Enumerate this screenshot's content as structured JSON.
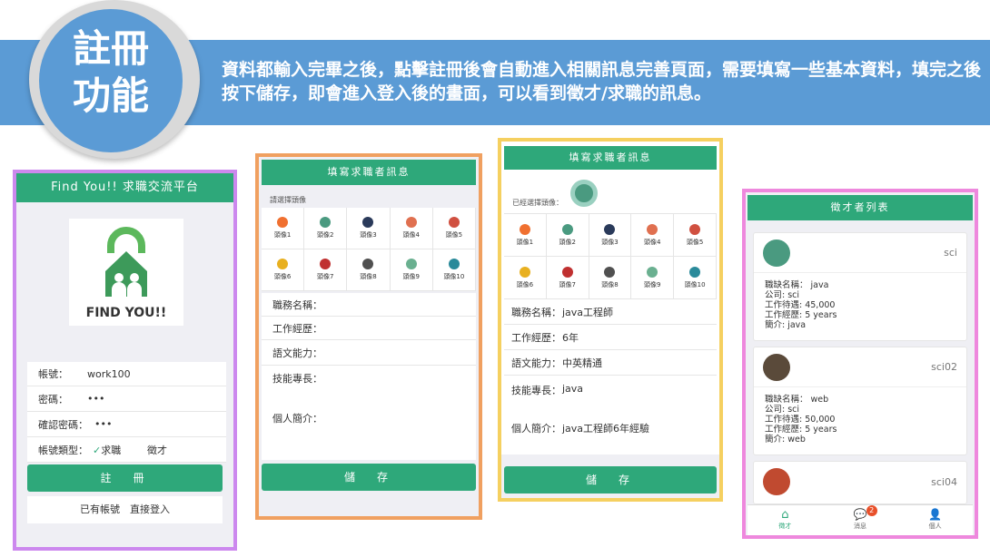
{
  "badge": {
    "line1": "註冊",
    "line2": "功能"
  },
  "banner": {
    "text": "資料都輸入完畢之後，點擊註冊後會自動進入相關訊息完善頁面，需要填寫一些基本資料，填完之後按下儲存，即會進入登入後的畫面，可以看到徵才/求職的訊息。"
  },
  "register": {
    "header": "Find You!! 求職交流平台",
    "logo_text": "FIND YOU!!",
    "fields": [
      {
        "label": "帳號：",
        "value": "work100"
      },
      {
        "label": "密碼：",
        "value": "•••"
      },
      {
        "label": "確認密碼：",
        "value": "•••"
      }
    ],
    "type_label": "帳號類型：",
    "type_option1": "求職",
    "type_option2": "徵才",
    "register_button": "註　冊",
    "login_link": "已有帳號　直接登入"
  },
  "form_empty": {
    "header": "填寫求職者訊息",
    "avatar_prompt": "請選擇頭像",
    "avatars": [
      "頭像1",
      "頭像2",
      "頭像3",
      "頭像4",
      "頭像5",
      "頭像6",
      "頭像7",
      "頭像8",
      "頭像9",
      "頭像10"
    ],
    "fields": [
      {
        "label": "職務名稱：",
        "value": ""
      },
      {
        "label": "工作經歷：",
        "value": ""
      },
      {
        "label": "語文能力：",
        "value": ""
      },
      {
        "label": "技能專長：",
        "value": ""
      },
      {
        "label": "個人簡介：",
        "value": ""
      }
    ],
    "save_button": "儲　存"
  },
  "form_filled": {
    "header": "填寫求職者訊息",
    "avatar_prompt": "已經選擇頭像：",
    "avatars": [
      "頭像1",
      "頭像2",
      "頭像3",
      "頭像4",
      "頭像5",
      "頭像6",
      "頭像7",
      "頭像8",
      "頭像9",
      "頭像10"
    ],
    "fields": [
      {
        "label": "職務名稱：",
        "value": "java工程師"
      },
      {
        "label": "工作經歷：",
        "value": "6年"
      },
      {
        "label": "語文能力：",
        "value": "中英精通"
      },
      {
        "label": "技能專長：",
        "value": "java"
      },
      {
        "label": "個人簡介：",
        "value": "java工程師6年經驗"
      }
    ],
    "save_button": "儲　存"
  },
  "recruiter_list": {
    "header": "徵才者列表",
    "cards": [
      {
        "name": "sci",
        "lines": [
          "職缺名稱： java",
          "公司: sci",
          "工作待遇: 45,000",
          "工作經歷: 5 years",
          "簡介: java"
        ]
      },
      {
        "name": "sci02",
        "lines": [
          "職缺名稱： web",
          "公司: sci",
          "工作待遇: 50,000",
          "工作經歷: 5 years",
          "簡介: web"
        ]
      },
      {
        "name": "sci04",
        "lines": []
      }
    ],
    "tabs": [
      {
        "label": "徵才"
      },
      {
        "label": "消息",
        "badge": "2"
      },
      {
        "label": "個人"
      }
    ]
  },
  "colors": {
    "accent": "#2ea87a",
    "banner": "#5b9bd5"
  }
}
